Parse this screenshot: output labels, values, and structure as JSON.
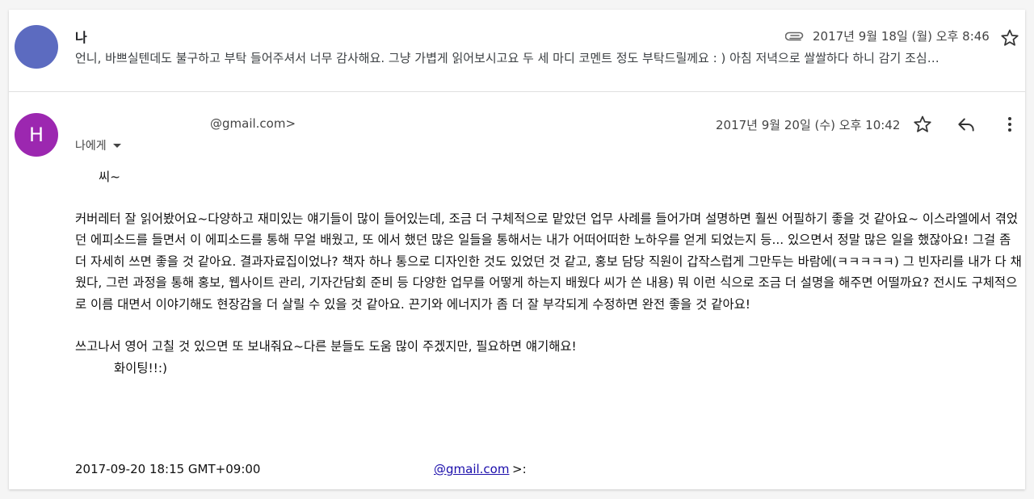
{
  "colors": {
    "avatar_me": "#5c6bc0",
    "avatar_h": "#9c27b0",
    "link": "#1a0dab"
  },
  "message1": {
    "sender": "나",
    "date": "2017년 9월 18일 (월) 오후 8:46",
    "snippet": "언니, 바쁘실텐데도 불구하고 부탁 들어주셔서 너무 감사해요. 그냥 가볍게 읽어보시고요 두 세 마디 코멘트 정도 부탁드릴께요 : ) 아침 저녁으로 쌀쌀하다 하니 감기 조심…",
    "icons": [
      "attachment-icon",
      "star-icon"
    ]
  },
  "message2": {
    "avatar_letter": "H",
    "sender_email": "@gmail.com>",
    "date": "2017년 9월 20일 (수) 오후 10:42",
    "recipient": "나에게",
    "icons": [
      "star-icon",
      "reply-icon",
      "more-vert-icon"
    ],
    "body": {
      "greeting": "씨~",
      "para1": "커버레터 잘 읽어봤어요~다양하고 재미있는 얘기들이 많이 들어있는데, 조금 더 구체적으로 맡았던 업무 사례를 들어가며 설명하면 훨씬 어필하기 좋을 것 같아요~ 이스라엘에서 겪었던 에피소드를 들면서 이 에피소드를 통해 무얼 배웠고, 또 에서 했던 많은 일들을 통해서는 내가 어떠어떠한 노하우를 얻게 되었는지 등... 있으면서 정말 많은 일을 했잖아요! 그걸 좀 더 자세히 쓰면 좋을 것 같아요. 결과자료집이었나? 책자 하나 통으로 디자인한 것도 있었던 것 같고, 홍보 담당 직원이 갑작스럽게 그만두는 바람에(ㅋㅋㅋㅋㅋ) 그 빈자리를 내가 다 채웠다, 그런 과정을 통해 홍보, 웹사이트 관리, 기자간담회 준비 등 다양한 업무를 어떻게 하는지 배웠다 씨가 쓴 내용) 뭐 이런 식으로 조금 더 설명을 해주면 어떨까요? 전시도 구체적으로 이름 대면서 이야기해도 현장감을 더 살릴 수 있을 것 같아요. 끈기와 에너지가 좀 더 잘 부각되게 수정하면 완전 좋을 것 같아요!",
      "para2": "쓰고나서 영어 고칠 것 있으면 또 보내줘요~다른 분들도 도움 많이 주겠지만, 필요하면 얘기해요!",
      "signoff": "화이팅!!:)"
    },
    "quote": {
      "header": "2017-09-20 18:15 GMT+09:00",
      "email": "@gmail.com",
      "tail": ">:"
    }
  }
}
